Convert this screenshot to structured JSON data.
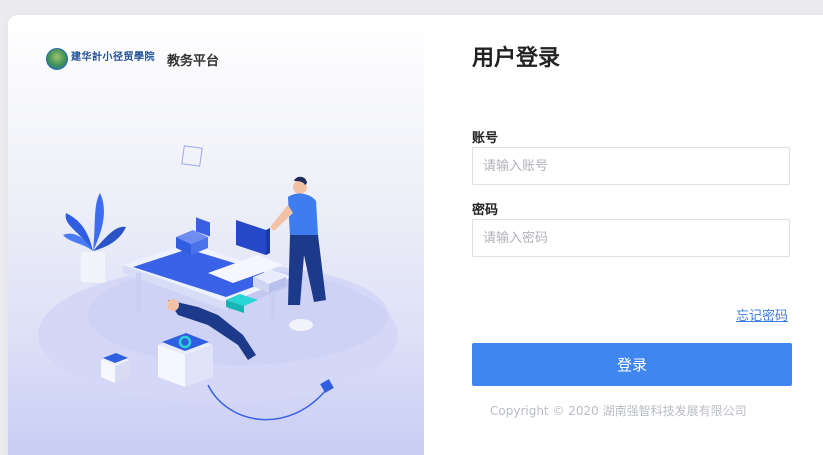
{
  "brand": {
    "logo_text": "建华計小径贸學院",
    "logo_subtext": "JIANHUA VOCATIONAL COLLEGE",
    "platform_name": "教务平台"
  },
  "login": {
    "title": "用户登录",
    "account_label": "账号",
    "account_placeholder": "请输入账号",
    "account_value": "",
    "password_label": "密码",
    "password_placeholder": "请输入密码",
    "password_value": "",
    "forgot_password": "忘记密码",
    "submit_label": "登录"
  },
  "footer": {
    "copyright": "Copyright © 2020 湖南强智科技发展有限公司"
  },
  "colors": {
    "accent": "#3f86f0",
    "link": "#3b7de0",
    "illustration_primary": "#2f5fe0"
  }
}
